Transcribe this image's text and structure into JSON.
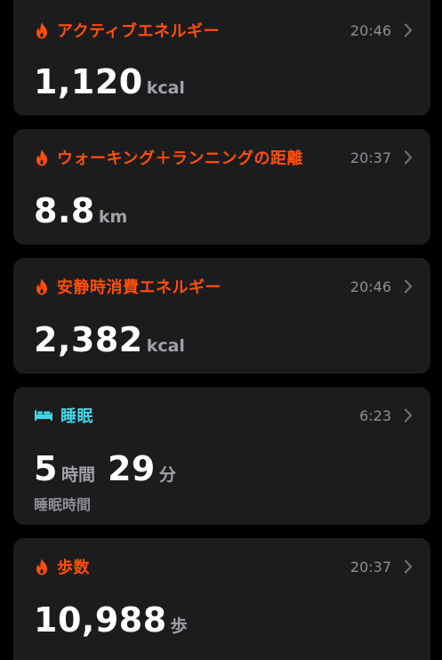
{
  "colors": {
    "activity_accent": "#ff4f0a",
    "sleep_accent": "#40d6e6",
    "card_bg": "#1c1c1e",
    "secondary_text": "#8e8e93"
  },
  "cards": [
    {
      "icon": "flame-icon",
      "title": "アクティブエネルギー",
      "time": "20:46",
      "value": "1,120",
      "unit": "kcal"
    },
    {
      "icon": "flame-icon",
      "title": "ウォーキング＋ランニングの距離",
      "time": "20:37",
      "value": "8.8",
      "unit": "km"
    },
    {
      "icon": "flame-icon",
      "title": "安静時消費エネルギー",
      "time": "20:46",
      "value": "2,382",
      "unit": "kcal"
    },
    {
      "icon": "bed-icon",
      "title": "睡眠",
      "time": "6:23",
      "hours": "5",
      "hours_unit": "時間",
      "minutes": "29",
      "minutes_unit": "分",
      "sub_label": "睡眠時間"
    },
    {
      "icon": "flame-icon",
      "title": "歩数",
      "time": "20:37",
      "value": "10,988",
      "unit": "歩"
    }
  ]
}
